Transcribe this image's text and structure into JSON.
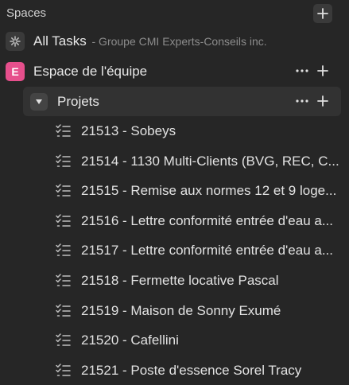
{
  "header": {
    "title": "Spaces"
  },
  "all_tasks": {
    "label": "All Tasks",
    "subtitle": "- Groupe CMI Experts-Conseils inc."
  },
  "space": {
    "badge": "E",
    "label": "Espace de l'équipe",
    "badge_color": "#e64f8c"
  },
  "folder": {
    "label": "Projets"
  },
  "lists": [
    {
      "label": "21513 - Sobeys"
    },
    {
      "label": "21514 - 1130 Multi-Clients (BVG, REC, C..."
    },
    {
      "label": "21515 - Remise aux normes 12 et 9 loge..."
    },
    {
      "label": "21516 - Lettre conformité entrée d'eau a..."
    },
    {
      "label": "21517 - Lettre conformité entrée d'eau a..."
    },
    {
      "label": "21518 - Fermette locative Pascal"
    },
    {
      "label": "21519 - Maison de Sonny Exumé"
    },
    {
      "label": "21520 - Cafellini"
    },
    {
      "label": "21521 - Poste d'essence Sorel Tracy"
    }
  ]
}
